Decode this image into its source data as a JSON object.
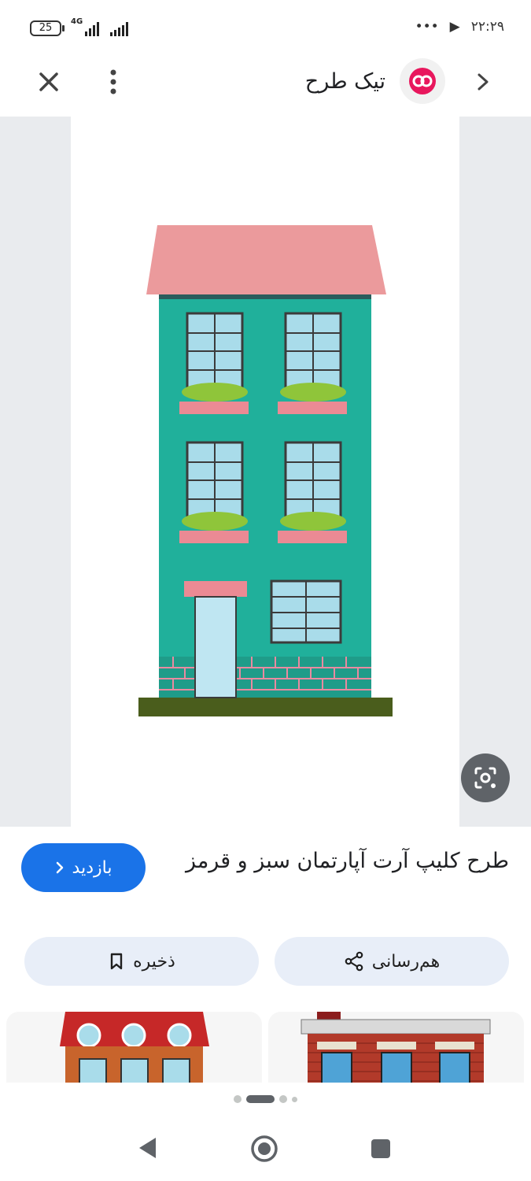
{
  "status_bar": {
    "battery": "25",
    "network": "4G",
    "time": "۲۲:۲۹",
    "more": "•••"
  },
  "header": {
    "site_name": "تیک طرح"
  },
  "image": {
    "subject": "apartment building clip art"
  },
  "result": {
    "title": "طرح کلیپ آرت آپارتمان سبز و قرمز",
    "visit_label": "بازدید"
  },
  "actions": {
    "save_label": "ذخیره",
    "share_label": "هم‌رسانی"
  },
  "colors": {
    "accent": "#1a73e8",
    "chip_bg": "#e8eef8",
    "logo_pink": "#e8175d",
    "building_teal": "#20b09b",
    "roof_pink": "#eb9a9c"
  }
}
